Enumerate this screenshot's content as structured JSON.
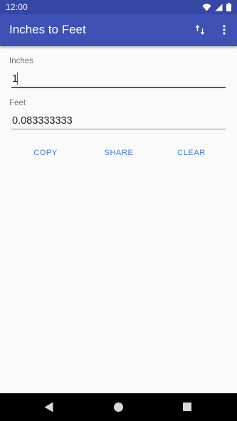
{
  "status_bar": {
    "time": "12:00",
    "icons": [
      "wifi-icon",
      "signal-icon",
      "battery-icon"
    ]
  },
  "app_bar": {
    "title": "Inches to Feet",
    "actions": [
      "swap-vert-icon",
      "more-vert-icon"
    ]
  },
  "inches": {
    "label": "Inches",
    "value": "1"
  },
  "feet": {
    "label": "Feet",
    "value": "0.083333333"
  },
  "buttons": {
    "copy": "COPY",
    "share": "SHARE",
    "clear": "CLEAR"
  },
  "colors": {
    "primary": "#3f51b5",
    "primary_dark": "#3747a6",
    "accent_text": "#3f7ad8",
    "background": "#fafafa"
  },
  "nav_bar": {
    "icons": [
      "back-icon",
      "home-icon",
      "recents-icon"
    ]
  }
}
